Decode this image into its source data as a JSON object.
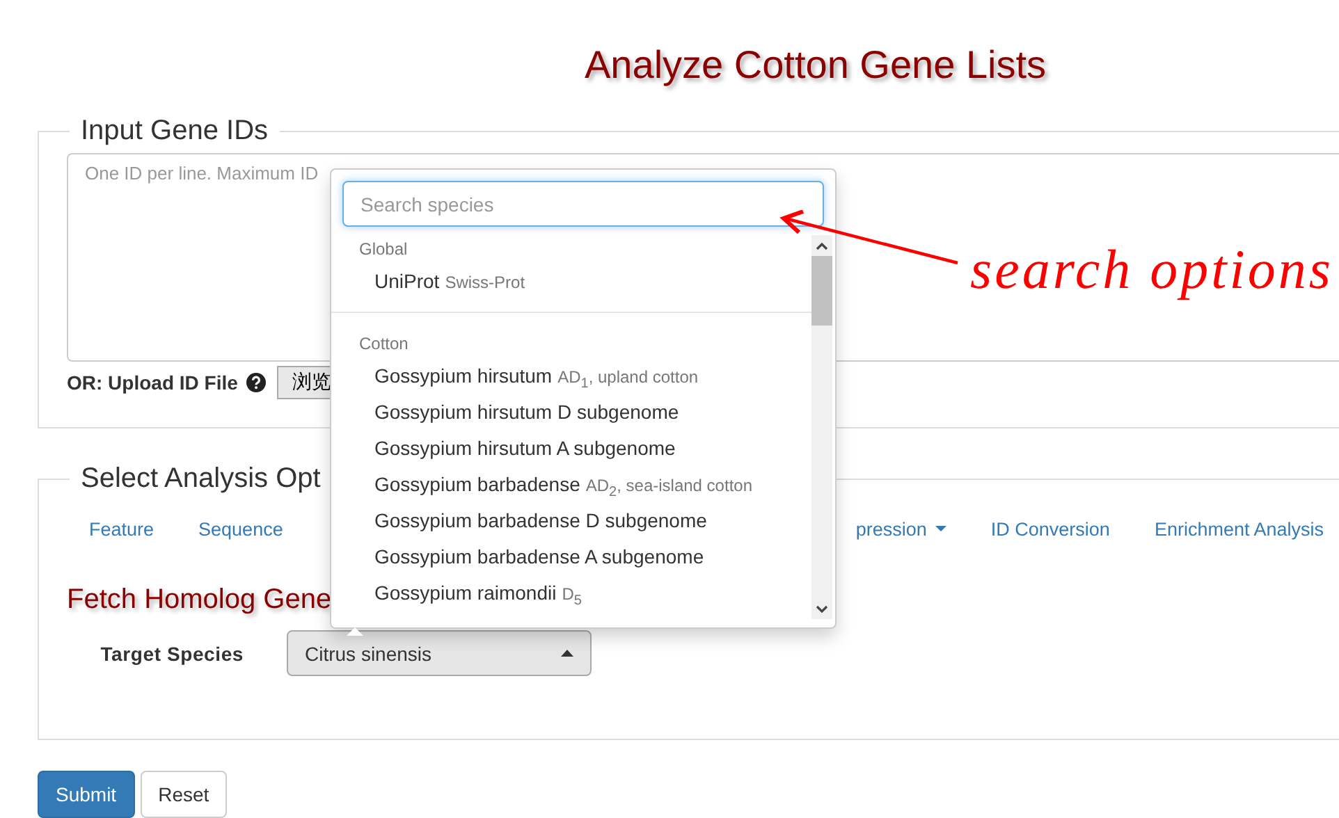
{
  "page_title": "Analyze Cotton Gene Lists",
  "input_section": {
    "legend": "Input Gene IDs",
    "textarea": {
      "placeholder": "One ID per line. Maximum ID"
    },
    "upload_label": "OR: Upload ID File",
    "browse_button": "浏览"
  },
  "analysis_section": {
    "legend": "Select Analysis Opt",
    "tabs": [
      {
        "label": "Feature",
        "kind": "link"
      },
      {
        "label": "Sequence",
        "kind": "link"
      },
      {
        "label": "pression",
        "kind": "dropdown"
      },
      {
        "label": "ID Conversion",
        "kind": "link"
      },
      {
        "label": "Enrichment Analysis",
        "kind": "link"
      }
    ],
    "heading": "Fetch Homolog Gene",
    "target_label": "Target Species",
    "species_select": {
      "value": "Citrus sinensis",
      "expanded": true
    }
  },
  "species_dropdown": {
    "search": {
      "placeholder": "Search species"
    },
    "groups": [
      {
        "label": "Global",
        "items": [
          {
            "name": "UniProt",
            "note": "Swiss-Prot"
          }
        ]
      },
      {
        "label": "Cotton",
        "items": [
          {
            "name": "Gossypium hirsutum",
            "note": "AD$_{1}$, upland cotton"
          },
          {
            "name": "Gossypium hirsutum D subgenome"
          },
          {
            "name": "Gossypium hirsutum A subgenome"
          },
          {
            "name": "Gossypium barbadense",
            "note": "AD$_{2}$, sea-island cotton"
          },
          {
            "name": "Gossypium barbadense D subgenome"
          },
          {
            "name": "Gossypium barbadense A subgenome"
          },
          {
            "name": "Gossypium raimondii",
            "note": "D$_{5}$"
          }
        ]
      }
    ]
  },
  "buttons": [
    {
      "label": "Submit",
      "kind": "primary"
    },
    {
      "label": "Reset",
      "kind": "default"
    }
  ],
  "annotation": {
    "text": "search options"
  }
}
